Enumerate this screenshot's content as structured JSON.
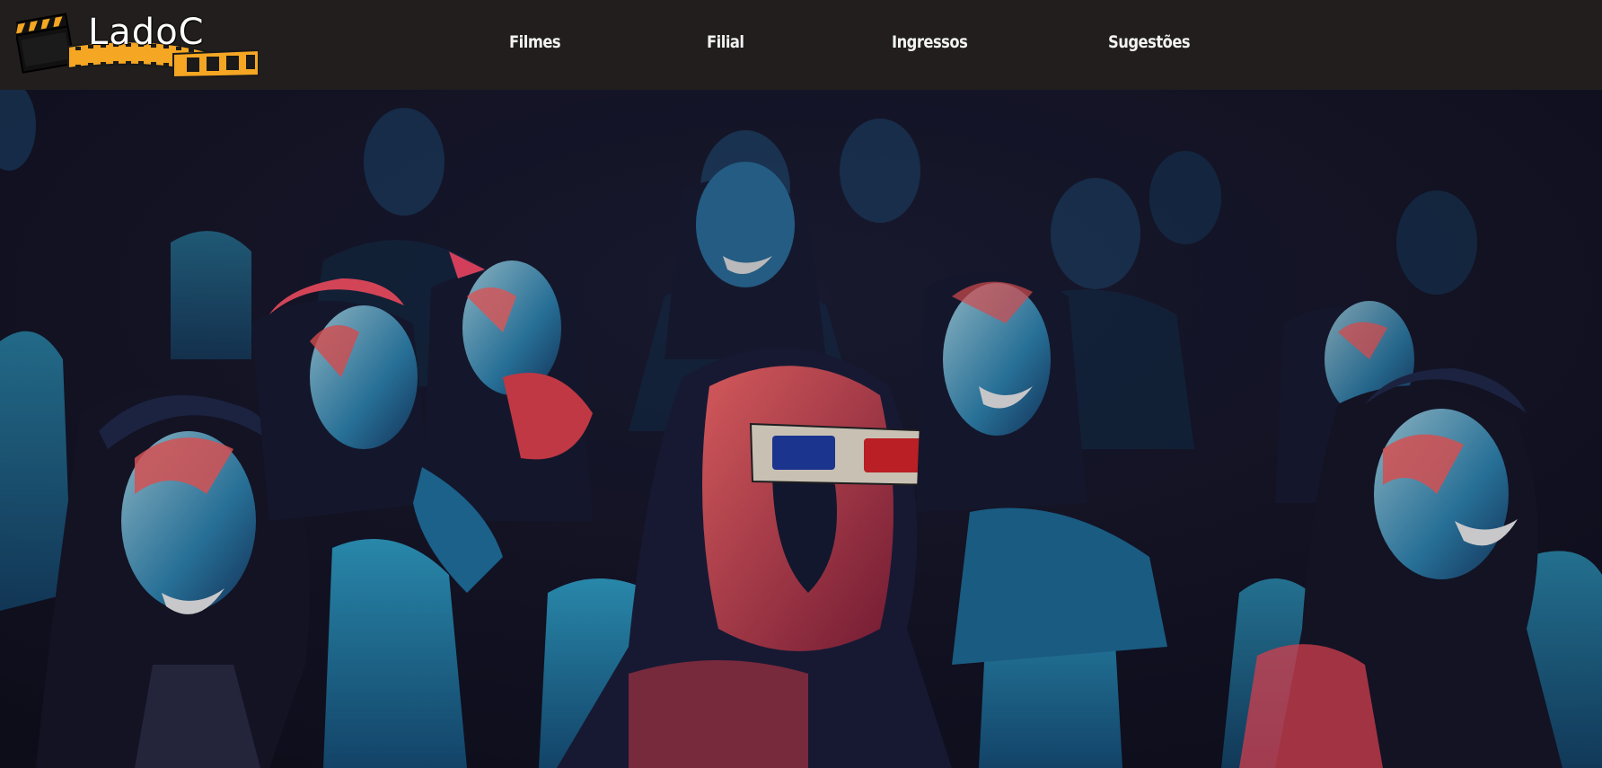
{
  "logo": {
    "text": "LadoC",
    "accent_color": "#f5a623"
  },
  "nav": {
    "items": [
      {
        "label": "Filmes"
      },
      {
        "label": "Filial"
      },
      {
        "label": "Ingressos"
      },
      {
        "label": "Sugestões"
      }
    ]
  },
  "hero": {
    "image_icon": "cinema-audience-illustration",
    "palette": {
      "background": "#141426",
      "cyan": "#1fa0c9",
      "red": "#e8434f",
      "lens_left": "#1f3ea8",
      "lens_right": "#e02428"
    }
  }
}
